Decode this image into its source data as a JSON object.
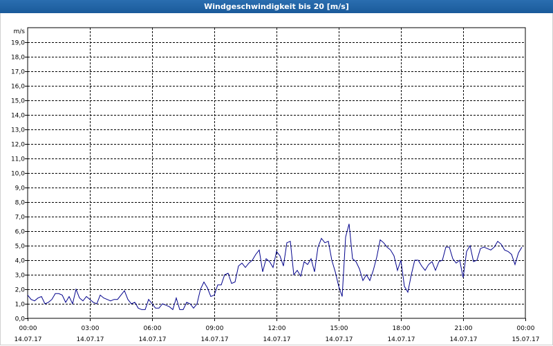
{
  "window": {
    "title": "Windgeschwindigkeit bis 20 [m/s]"
  },
  "chart_data": {
    "type": "line",
    "title": "Windgeschwindigkeit bis 20 [m/s]",
    "ylabel": "m/s",
    "xlabel": "",
    "ylim": [
      0,
      20
    ],
    "xlim": [
      "14.07.17 00:00",
      "15.07.17 00:00"
    ],
    "grid": true,
    "y_ticks": [
      "0,0",
      "1,0",
      "2,0",
      "3,0",
      "4,0",
      "5,0",
      "6,0",
      "7,0",
      "8,0",
      "9,0",
      "10,0",
      "11,0",
      "12,0",
      "13,0",
      "14,0",
      "15,0",
      "16,0",
      "17,0",
      "18,0",
      "19,0"
    ],
    "x_ticks": [
      {
        "time": "00:00",
        "date": "14.07.17"
      },
      {
        "time": "03:00",
        "date": "14.07.17"
      },
      {
        "time": "06:00",
        "date": "14.07.17"
      },
      {
        "time": "09:00",
        "date": "14.07.17"
      },
      {
        "time": "12:00",
        "date": "14.07.17"
      },
      {
        "time": "15:00",
        "date": "14.07.17"
      },
      {
        "time": "18:00",
        "date": "14.07.17"
      },
      {
        "time": "21:00",
        "date": "14.07.17"
      },
      {
        "time": "00:00",
        "date": "15.07.17"
      }
    ],
    "series": [
      {
        "color": "#00008b",
        "points": [
          [
            "00:00",
            1.6
          ],
          [
            "00:10",
            1.3
          ],
          [
            "00:20",
            1.2
          ],
          [
            "00:30",
            1.4
          ],
          [
            "00:40",
            1.5
          ],
          [
            "00:50",
            1.0
          ],
          [
            "01:00",
            1.1
          ],
          [
            "01:10",
            1.3
          ],
          [
            "01:20",
            1.7
          ],
          [
            "01:30",
            1.7
          ],
          [
            "01:40",
            1.6
          ],
          [
            "01:50",
            1.1
          ],
          [
            "02:00",
            1.5
          ],
          [
            "02:10",
            1.0
          ],
          [
            "02:20",
            2.0
          ],
          [
            "02:30",
            1.4
          ],
          [
            "02:40",
            1.2
          ],
          [
            "02:50",
            1.5
          ],
          [
            "03:00",
            1.3
          ],
          [
            "03:10",
            1.1
          ],
          [
            "03:20",
            1.0
          ],
          [
            "03:30",
            1.6
          ],
          [
            "03:40",
            1.4
          ],
          [
            "03:50",
            1.3
          ],
          [
            "04:00",
            1.2
          ],
          [
            "04:10",
            1.3
          ],
          [
            "04:20",
            1.3
          ],
          [
            "04:30",
            1.6
          ],
          [
            "04:40",
            1.9
          ],
          [
            "04:50",
            1.3
          ],
          [
            "05:00",
            1.0
          ],
          [
            "05:10",
            1.1
          ],
          [
            "05:20",
            0.7
          ],
          [
            "05:30",
            0.6
          ],
          [
            "05:40",
            0.6
          ],
          [
            "05:50",
            1.3
          ],
          [
            "06:00",
            1.0
          ],
          [
            "06:10",
            0.7
          ],
          [
            "06:20",
            0.7
          ],
          [
            "06:30",
            1.0
          ],
          [
            "06:40",
            0.9
          ],
          [
            "06:50",
            0.8
          ],
          [
            "07:00",
            0.6
          ],
          [
            "07:10",
            1.4
          ],
          [
            "07:20",
            0.6
          ],
          [
            "07:30",
            0.6
          ],
          [
            "07:40",
            1.1
          ],
          [
            "07:50",
            1.0
          ],
          [
            "08:00",
            0.7
          ],
          [
            "08:10",
            1.0
          ],
          [
            "08:20",
            2.0
          ],
          [
            "08:30",
            2.5
          ],
          [
            "08:40",
            2.1
          ],
          [
            "08:50",
            1.5
          ],
          [
            "09:00",
            1.6
          ],
          [
            "09:10",
            2.3
          ],
          [
            "09:20",
            2.3
          ],
          [
            "09:30",
            3.0
          ],
          [
            "09:40",
            3.1
          ],
          [
            "09:50",
            2.4
          ],
          [
            "10:00",
            2.5
          ],
          [
            "10:10",
            3.6
          ],
          [
            "10:20",
            3.8
          ],
          [
            "10:30",
            3.5
          ],
          [
            "10:40",
            3.8
          ],
          [
            "10:50",
            4.0
          ],
          [
            "11:00",
            4.4
          ],
          [
            "11:10",
            4.7
          ],
          [
            "11:20",
            3.2
          ],
          [
            "11:30",
            4.1
          ],
          [
            "11:40",
            3.9
          ],
          [
            "11:50",
            3.5
          ],
          [
            "12:00",
            4.6
          ],
          [
            "12:10",
            4.3
          ],
          [
            "12:20",
            3.6
          ],
          [
            "12:30",
            5.2
          ],
          [
            "12:40",
            5.3
          ],
          [
            "12:50",
            3.0
          ],
          [
            "13:00",
            3.3
          ],
          [
            "13:10",
            2.9
          ],
          [
            "13:20",
            3.9
          ],
          [
            "13:30",
            3.7
          ],
          [
            "13:40",
            4.1
          ],
          [
            "13:50",
            3.2
          ],
          [
            "14:00",
            4.9
          ],
          [
            "14:10",
            5.5
          ],
          [
            "14:20",
            5.2
          ],
          [
            "14:30",
            5.3
          ],
          [
            "14:40",
            4.0
          ],
          [
            "14:50",
            3.2
          ],
          [
            "15:00",
            2.2
          ],
          [
            "15:10",
            1.5
          ],
          [
            "15:20",
            5.6
          ],
          [
            "15:30",
            6.5
          ],
          [
            "15:40",
            4.1
          ],
          [
            "15:50",
            3.9
          ],
          [
            "16:00",
            3.4
          ],
          [
            "16:10",
            2.6
          ],
          [
            "16:20",
            3.0
          ],
          [
            "16:30",
            2.6
          ],
          [
            "16:40",
            3.3
          ],
          [
            "16:50",
            4.2
          ],
          [
            "17:00",
            5.4
          ],
          [
            "17:10",
            5.2
          ],
          [
            "17:20",
            4.9
          ],
          [
            "17:30",
            4.7
          ],
          [
            "17:40",
            4.3
          ],
          [
            "17:50",
            3.3
          ],
          [
            "18:00",
            4.0
          ],
          [
            "18:10",
            2.2
          ],
          [
            "18:20",
            1.8
          ],
          [
            "18:30",
            3.0
          ],
          [
            "18:40",
            4.0
          ],
          [
            "18:50",
            4.0
          ],
          [
            "19:00",
            3.6
          ],
          [
            "19:10",
            3.3
          ],
          [
            "19:20",
            3.7
          ],
          [
            "19:30",
            3.9
          ],
          [
            "19:40",
            3.3
          ],
          [
            "19:50",
            3.9
          ],
          [
            "20:00",
            4.0
          ],
          [
            "20:10",
            4.9
          ],
          [
            "20:20",
            4.9
          ],
          [
            "20:30",
            4.1
          ],
          [
            "20:40",
            3.8
          ],
          [
            "20:50",
            4.0
          ],
          [
            "21:00",
            2.8
          ],
          [
            "21:10",
            4.6
          ],
          [
            "21:20",
            5.0
          ],
          [
            "21:30",
            3.9
          ],
          [
            "21:40",
            4.0
          ],
          [
            "21:50",
            4.8
          ],
          [
            "22:00",
            4.9
          ],
          [
            "22:10",
            4.8
          ],
          [
            "22:20",
            4.7
          ],
          [
            "22:30",
            4.9
          ],
          [
            "22:40",
            5.3
          ],
          [
            "22:50",
            5.1
          ],
          [
            "23:00",
            4.7
          ],
          [
            "23:10",
            4.6
          ],
          [
            "23:20",
            4.4
          ],
          [
            "23:30",
            3.7
          ],
          [
            "23:40",
            4.5
          ],
          [
            "23:50",
            4.9
          ]
        ]
      }
    ]
  }
}
